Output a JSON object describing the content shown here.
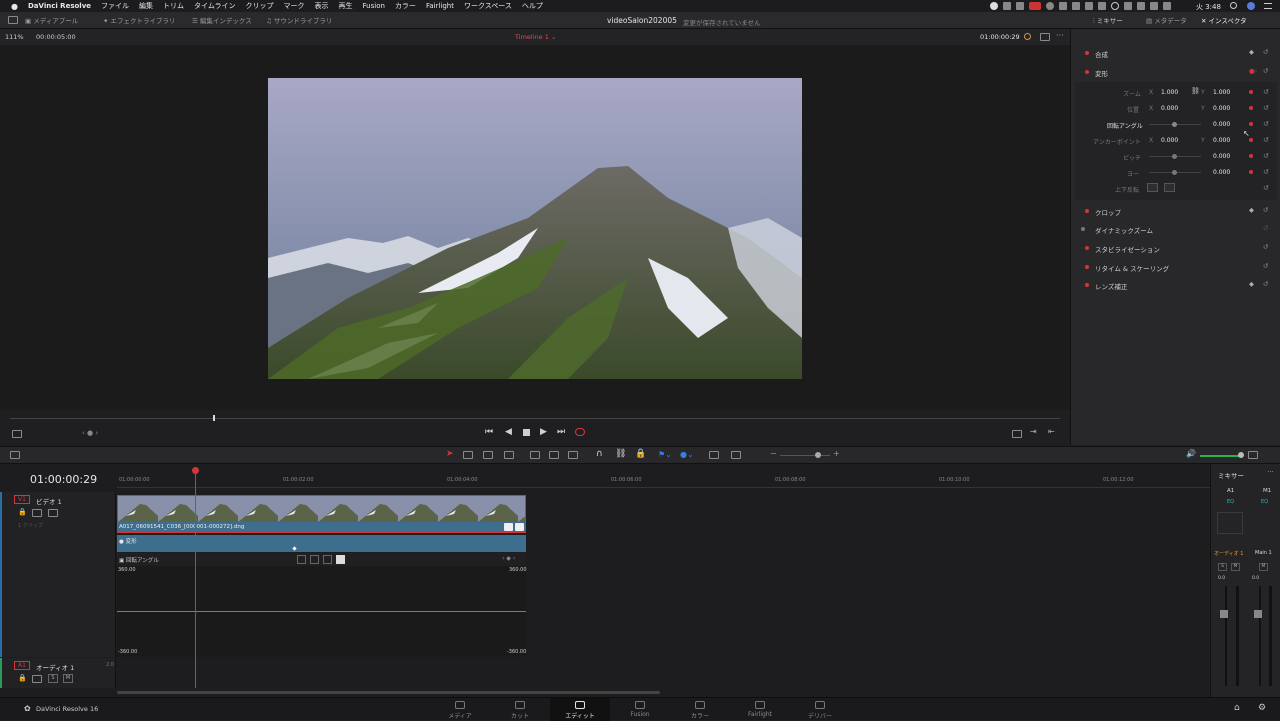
{
  "menubar": {
    "app": "DaVinci Resolve",
    "items": [
      "ファイル",
      "編集",
      "トリム",
      "タイムライン",
      "クリップ",
      "マーク",
      "表示",
      "再生",
      "Fusion",
      "カラー",
      "Fairlight",
      "ワークスペース",
      "ヘルプ"
    ],
    "time": "火 3:48"
  },
  "toolbar": {
    "media_pool": "メディアプール",
    "effects": "エフェクトライブラリ",
    "index": "編集インデックス",
    "sound": "サウンドライブラリ",
    "project": "videoSalon202005",
    "status": "変更が保存されていません",
    "mixer": "ミキサー",
    "metadata": "メタデータ",
    "inspector": "インスペクタ"
  },
  "viewer": {
    "zoom": "111%",
    "duration": "00:00:05:00",
    "timeline_name": "Timeline 1",
    "timecode": "01:00:00:29"
  },
  "inspector": {
    "composite": "合成",
    "transform": "変形",
    "zoom_label": "ズーム",
    "zoom_x": "1.000",
    "zoom_y": "1.000",
    "position_label": "位置",
    "pos_x": "0.000",
    "pos_y": "0.000",
    "rotation_label": "回転アングル",
    "rotation": "0.000",
    "anchor_label": "アンカーポイント",
    "anchor_x": "0.000",
    "anchor_y": "0.000",
    "pitch_label": "ピッチ",
    "pitch": "0.000",
    "yaw_label": "ヨー",
    "yaw": "0.000",
    "flip_label": "上下反転",
    "crop": "クロップ",
    "dynamic_zoom": "ダイナミックズーム",
    "stabilization": "スタビライゼーション",
    "retime": "リタイム & スケーリング",
    "lens": "レンズ補正",
    "x": "X",
    "y": "Y"
  },
  "timeline": {
    "timecode": "01:00:00:29",
    "ruler": [
      "01:00:00:00",
      "01:00:02:00",
      "01:00:04:00",
      "01:00:06:00",
      "01:00:08:00",
      "01:00:10:00",
      "01:00:12:00"
    ],
    "v1_tag": "V1",
    "v1_name": "ビデオ 1",
    "v1_clips": "1 クリップ",
    "clip_name": "A017_06091541_C036_[000001-000272].dng",
    "keyframe_track": "変形",
    "curve_label": "回転アングル",
    "curve_top_left": "360.00",
    "curve_top_right": "360.00",
    "curve_bottom_left": "-360.00",
    "curve_bottom_right": "-360.00",
    "a1_tag": "A1",
    "a1_name": "オーディオ 1",
    "a1_level": "2.0",
    "s": "S",
    "m": "M"
  },
  "mixer": {
    "title": "ミキサー",
    "a1": "A1",
    "m1": "M1",
    "eq": "EQ",
    "audio1": "オーディオ 1",
    "main1": "Main 1",
    "level_a": "0.0",
    "level_b": "0.0",
    "s": "S",
    "m": "M"
  },
  "bottombar": {
    "product": "DaVinci Resolve 16",
    "pages": [
      "メディア",
      "カット",
      "エディット",
      "Fusion",
      "カラー",
      "Fairlight",
      "デリバー"
    ]
  },
  "colors": {
    "accent_red": "#d8333a",
    "clip_blue": "#3e6e8e",
    "curve_teal": "#2fa09a"
  }
}
